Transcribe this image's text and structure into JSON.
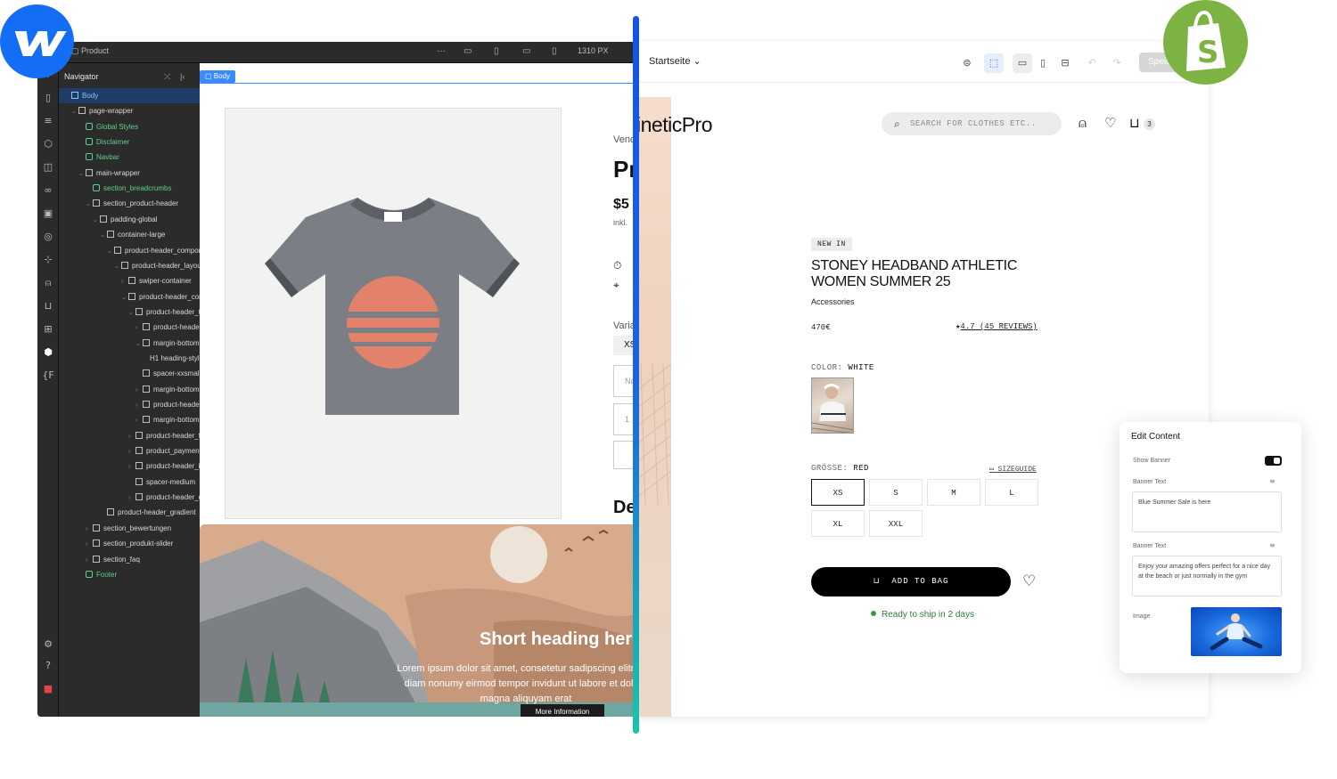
{
  "webflow": {
    "breadcrumb": "Product",
    "viewport_width": "1310 PX",
    "navigator_title": "Navigator",
    "body_tag": "Body",
    "tree": [
      {
        "label": "Body",
        "indent": 0,
        "type": "sel",
        "caret": ""
      },
      {
        "label": "page-wrapper",
        "indent": 1,
        "type": "el",
        "caret": "⌄"
      },
      {
        "label": "Global Styles",
        "indent": 2,
        "type": "comp",
        "caret": ""
      },
      {
        "label": "Disclaimer",
        "indent": 2,
        "type": "comp",
        "caret": ""
      },
      {
        "label": "Navbar",
        "indent": 2,
        "type": "comp",
        "caret": ""
      },
      {
        "label": "main-wrapper",
        "indent": 2,
        "type": "el",
        "caret": "⌄"
      },
      {
        "label": "section_breadcrumbs",
        "indent": 3,
        "type": "comp",
        "caret": ""
      },
      {
        "label": "section_product-header",
        "indent": 3,
        "type": "el",
        "caret": "⌄"
      },
      {
        "label": "padding-global",
        "indent": 4,
        "type": "el",
        "caret": "⌄"
      },
      {
        "label": "container-large",
        "indent": 5,
        "type": "el",
        "caret": "⌄"
      },
      {
        "label": "product-header_component",
        "indent": 6,
        "type": "el",
        "caret": "⌄"
      },
      {
        "label": "product-header_layout",
        "indent": 7,
        "type": "el",
        "caret": "⌄"
      },
      {
        "label": "swiper-container",
        "indent": 8,
        "type": "el",
        "caret": "›"
      },
      {
        "label": "product-header_content",
        "indent": 8,
        "type": "el",
        "caret": "⌄"
      },
      {
        "label": "product-header_top",
        "indent": 9,
        "type": "el",
        "caret": "⌄"
      },
      {
        "label": "product-header_tag",
        "indent": 10,
        "type": "el",
        "caret": "›"
      },
      {
        "label": "margin-bottom",
        "indent": 10,
        "type": "el",
        "caret": "⌄"
      },
      {
        "label": "H1 heading-style",
        "indent": 11,
        "type": "text",
        "caret": ""
      },
      {
        "label": "spacer-xxsmall",
        "indent": 10,
        "type": "el",
        "caret": ""
      },
      {
        "label": "margin-bottom",
        "indent": 10,
        "type": "el",
        "caret": "›"
      },
      {
        "label": "product-header_price",
        "indent": 10,
        "type": "el",
        "caret": "›"
      },
      {
        "label": "margin-bottom",
        "indent": 10,
        "type": "el",
        "caret": "›"
      },
      {
        "label": "product-header_form",
        "indent": 9,
        "type": "el",
        "caret": "›"
      },
      {
        "label": "product_payment",
        "indent": 9,
        "type": "list",
        "caret": "›"
      },
      {
        "label": "product-header_info",
        "indent": 9,
        "type": "el",
        "caret": "›"
      },
      {
        "label": "spacer-medium",
        "indent": 9,
        "type": "el",
        "caret": ""
      },
      {
        "label": "product-header_details",
        "indent": 9,
        "type": "el",
        "caret": "›"
      },
      {
        "label": "product-header_gradient",
        "indent": 5,
        "type": "el",
        "caret": ""
      },
      {
        "label": "section_bewertungen",
        "indent": 3,
        "type": "el",
        "caret": "›"
      },
      {
        "label": "section_produkt-slider",
        "indent": 3,
        "type": "el",
        "caret": "›"
      },
      {
        "label": "section_faq",
        "indent": 3,
        "type": "el",
        "caret": "›"
      },
      {
        "label": "Footer",
        "indent": 2,
        "type": "comp",
        "caret": ""
      }
    ],
    "canvas": {
      "vendor": "Vendor",
      "product_initial": "Pr",
      "price_partial": "$5",
      "tax_partial": "inkl.",
      "variant_label": "Varia",
      "variant_value": "XS",
      "input1": "Na",
      "input2": "1",
      "desc_partial": "De",
      "hero_title": "Short heading here",
      "hero_text": "Lorem ipsum dolor sit amet, consetetur sadipscing elitr, sed diam nonumy eirmod tempor invidunt ut labore et dolore magna aliquyam erat",
      "hero_button": "More Information"
    }
  },
  "shop": {
    "page_select": "Startseite",
    "save_label": "Speichern",
    "logo": "ineticPro",
    "search_placeholder": "SEARCH FOR CLOTHES ETC..",
    "cart_count": "3",
    "badge": "NEW IN",
    "product_title": "STONEY HEADBAND ATHLETIC WOMEN SUMMER 25",
    "category": "Accessories",
    "price": "470€",
    "rating_star": "★",
    "rating": "4.7 (45 REVIEWS)",
    "color_label": "COLOR:",
    "color_value": "WHITE",
    "size_label": "GRÖSSE:",
    "size_value": "RED",
    "sizeguide": "SIZEGUIDE",
    "sizes": [
      "XS",
      "S",
      "M",
      "L",
      "XL",
      "XXL"
    ],
    "selected_size": "XS",
    "add_to_bag": "ADD TO BAG",
    "ship_text": "Ready to ship in 2 days"
  },
  "edit_panel": {
    "title": "Edit Content",
    "show_banner_label": "Show Banner",
    "show_banner_on": true,
    "banner_text_label_1": "Banner Text",
    "banner_text_value_1": "Blue Summer Sale is here",
    "banner_text_label_2": "Banner Text",
    "banner_text_value_2": "Enjoy your amazing offers perfect for a nice day at the beach or just normally in the gym",
    "image_label": "Image"
  },
  "colors": {
    "webflow_blue": "#146ef5",
    "shopify_green": "#7cb342",
    "editor_bg": "#1e1e1e",
    "navigator_bg": "#2b2b2b",
    "component_green": "#5fd08f",
    "ship_green": "#2f7d32"
  },
  "icons": {
    "webflow": "webflow-logo",
    "shopify": "shopify-bag-logo",
    "search": "search-icon",
    "account": "user-icon",
    "wishlist": "heart-icon",
    "cart": "shopping-bag-icon"
  }
}
